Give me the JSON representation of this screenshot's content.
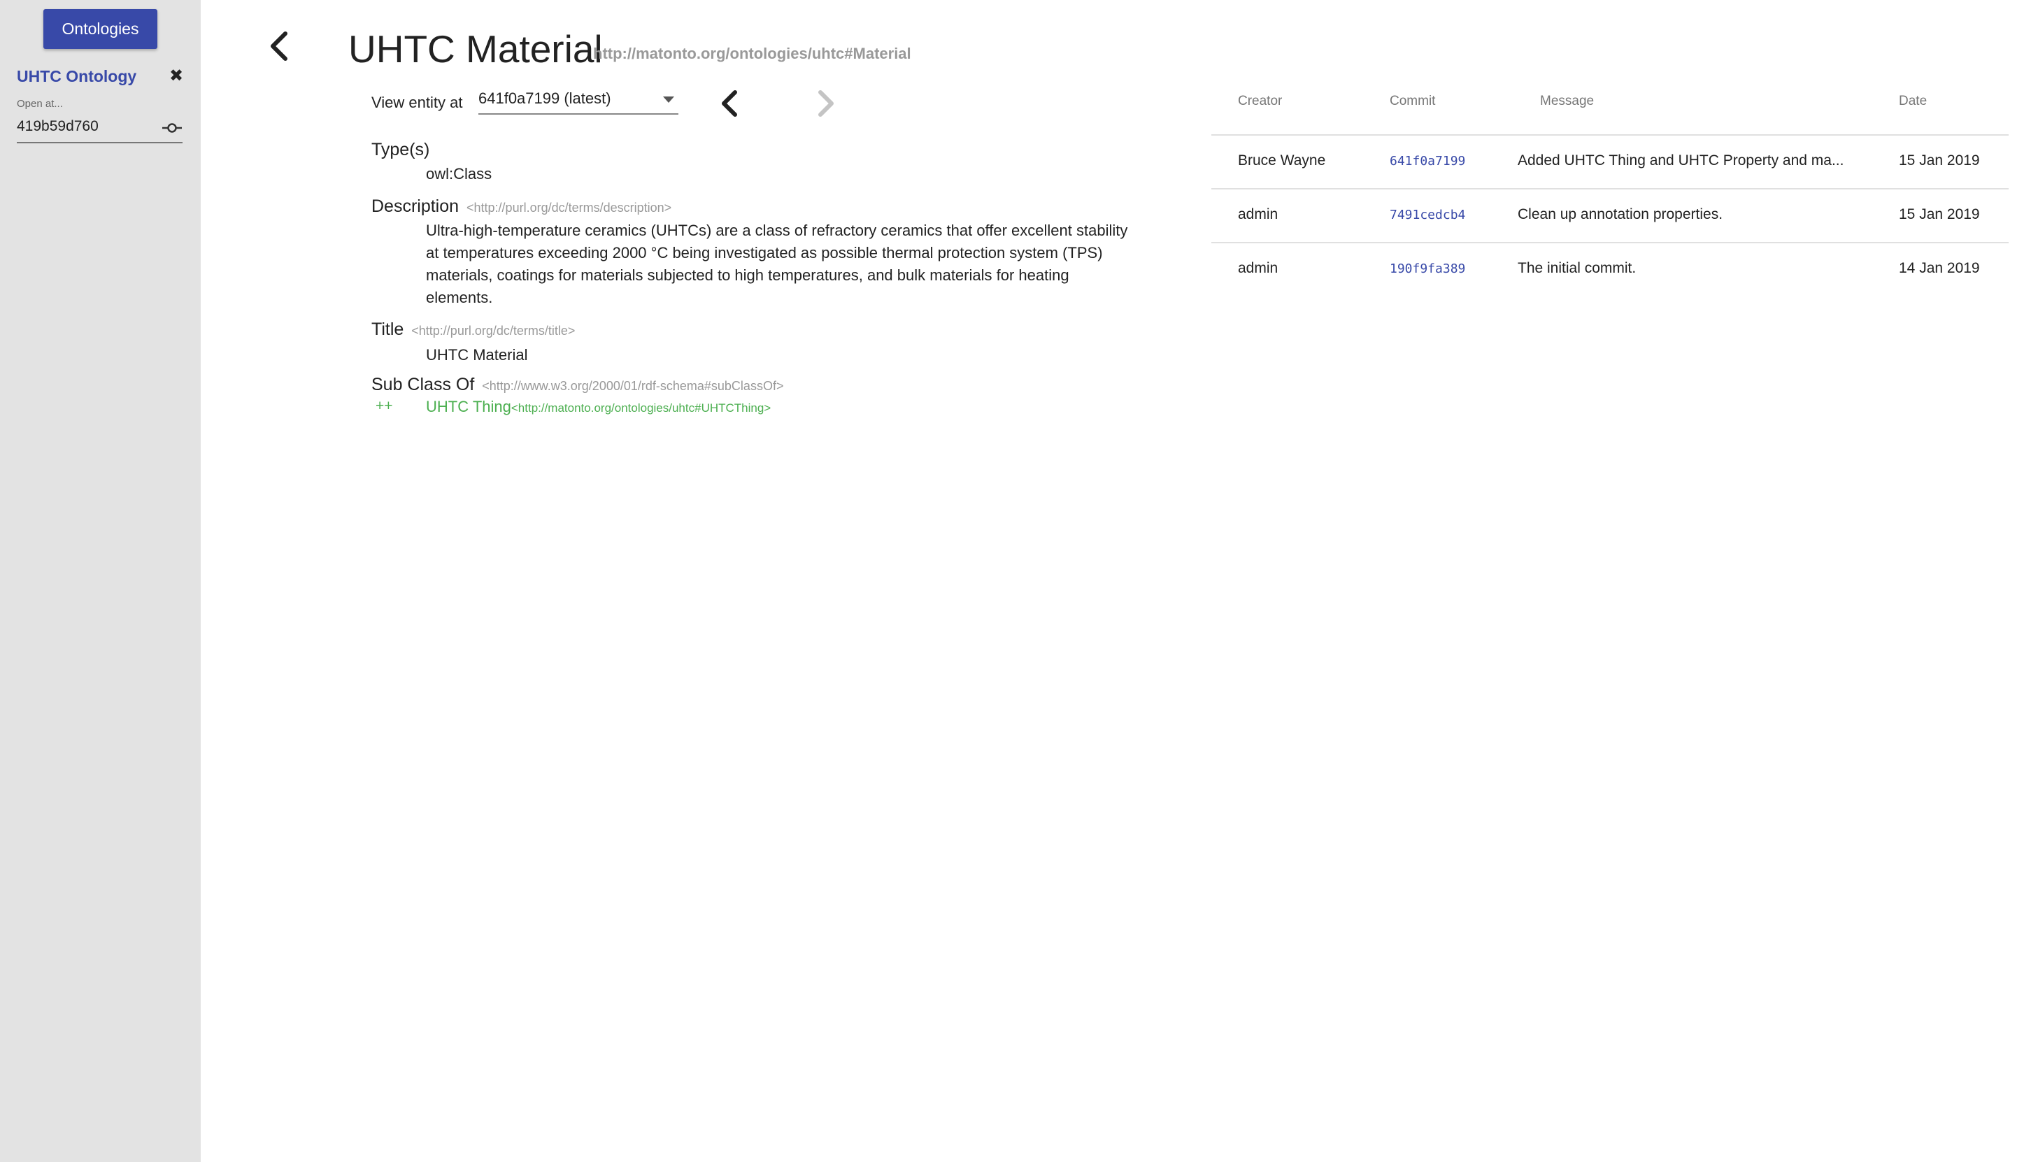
{
  "sidebar": {
    "ontologies_button": "Ontologies",
    "open_ontology": {
      "name": "UHTC Ontology",
      "open_at_label": "Open at...",
      "commit": "419b59d760",
      "close_icon": "close-icon",
      "commit_icon": "commit-icon"
    }
  },
  "entity": {
    "title": "UHTC Material",
    "iri": "http://matonto.org/ontologies/uhtc#Material",
    "view_at_label": "View entity at",
    "selected_commit": "641f0a7199 (latest)",
    "back_icon": "chevron-left-icon",
    "prev_icon": "chevron-left-icon",
    "next_icon": "chevron-right-icon"
  },
  "properties": {
    "types": {
      "label": "Type(s)",
      "value": "owl:Class"
    },
    "description": {
      "label": "Description",
      "iri": "<http://purl.org/dc/terms/description>",
      "value": "Ultra-high-temperature ceramics (UHTCs) are a class of refractory ceramics that offer excellent stability at temperatures exceeding 2000 °C being investigated as possible thermal protection system (TPS) materials, coatings for materials subjected to high temperatures, and bulk materials for heating elements."
    },
    "title": {
      "label": "Title",
      "iri": "<http://purl.org/dc/terms/title>",
      "value": "UHTC Material"
    },
    "sub_class_of": {
      "label": "Sub Class Of",
      "iri": "<http://www.w3.org/2000/01/rdf-schema#subClassOf>",
      "added_marker": "++",
      "value": "UHTC Thing",
      "value_iri": "<http://matonto.org/ontologies/uhtc#UHTCThing>"
    }
  },
  "history": {
    "headers": {
      "creator": "Creator",
      "commit": "Commit",
      "message": "Message",
      "date": "Date"
    },
    "rows": [
      {
        "creator": "Bruce Wayne",
        "commit": "641f0a7199",
        "message": "Added UHTC Thing and UHTC Property and ma...",
        "date": "15 Jan 2019"
      },
      {
        "creator": "admin",
        "commit": "7491cedcb4",
        "message": "Clean up annotation properties.",
        "date": "15 Jan 2019"
      },
      {
        "creator": "admin",
        "commit": "190f9fa389",
        "message": "The initial commit.",
        "date": "14 Jan 2019"
      }
    ]
  },
  "colors": {
    "primary": "#3849a8",
    "added": "#4caf50",
    "sidebar_bg": "#e3e3e3",
    "muted": "#999999"
  }
}
